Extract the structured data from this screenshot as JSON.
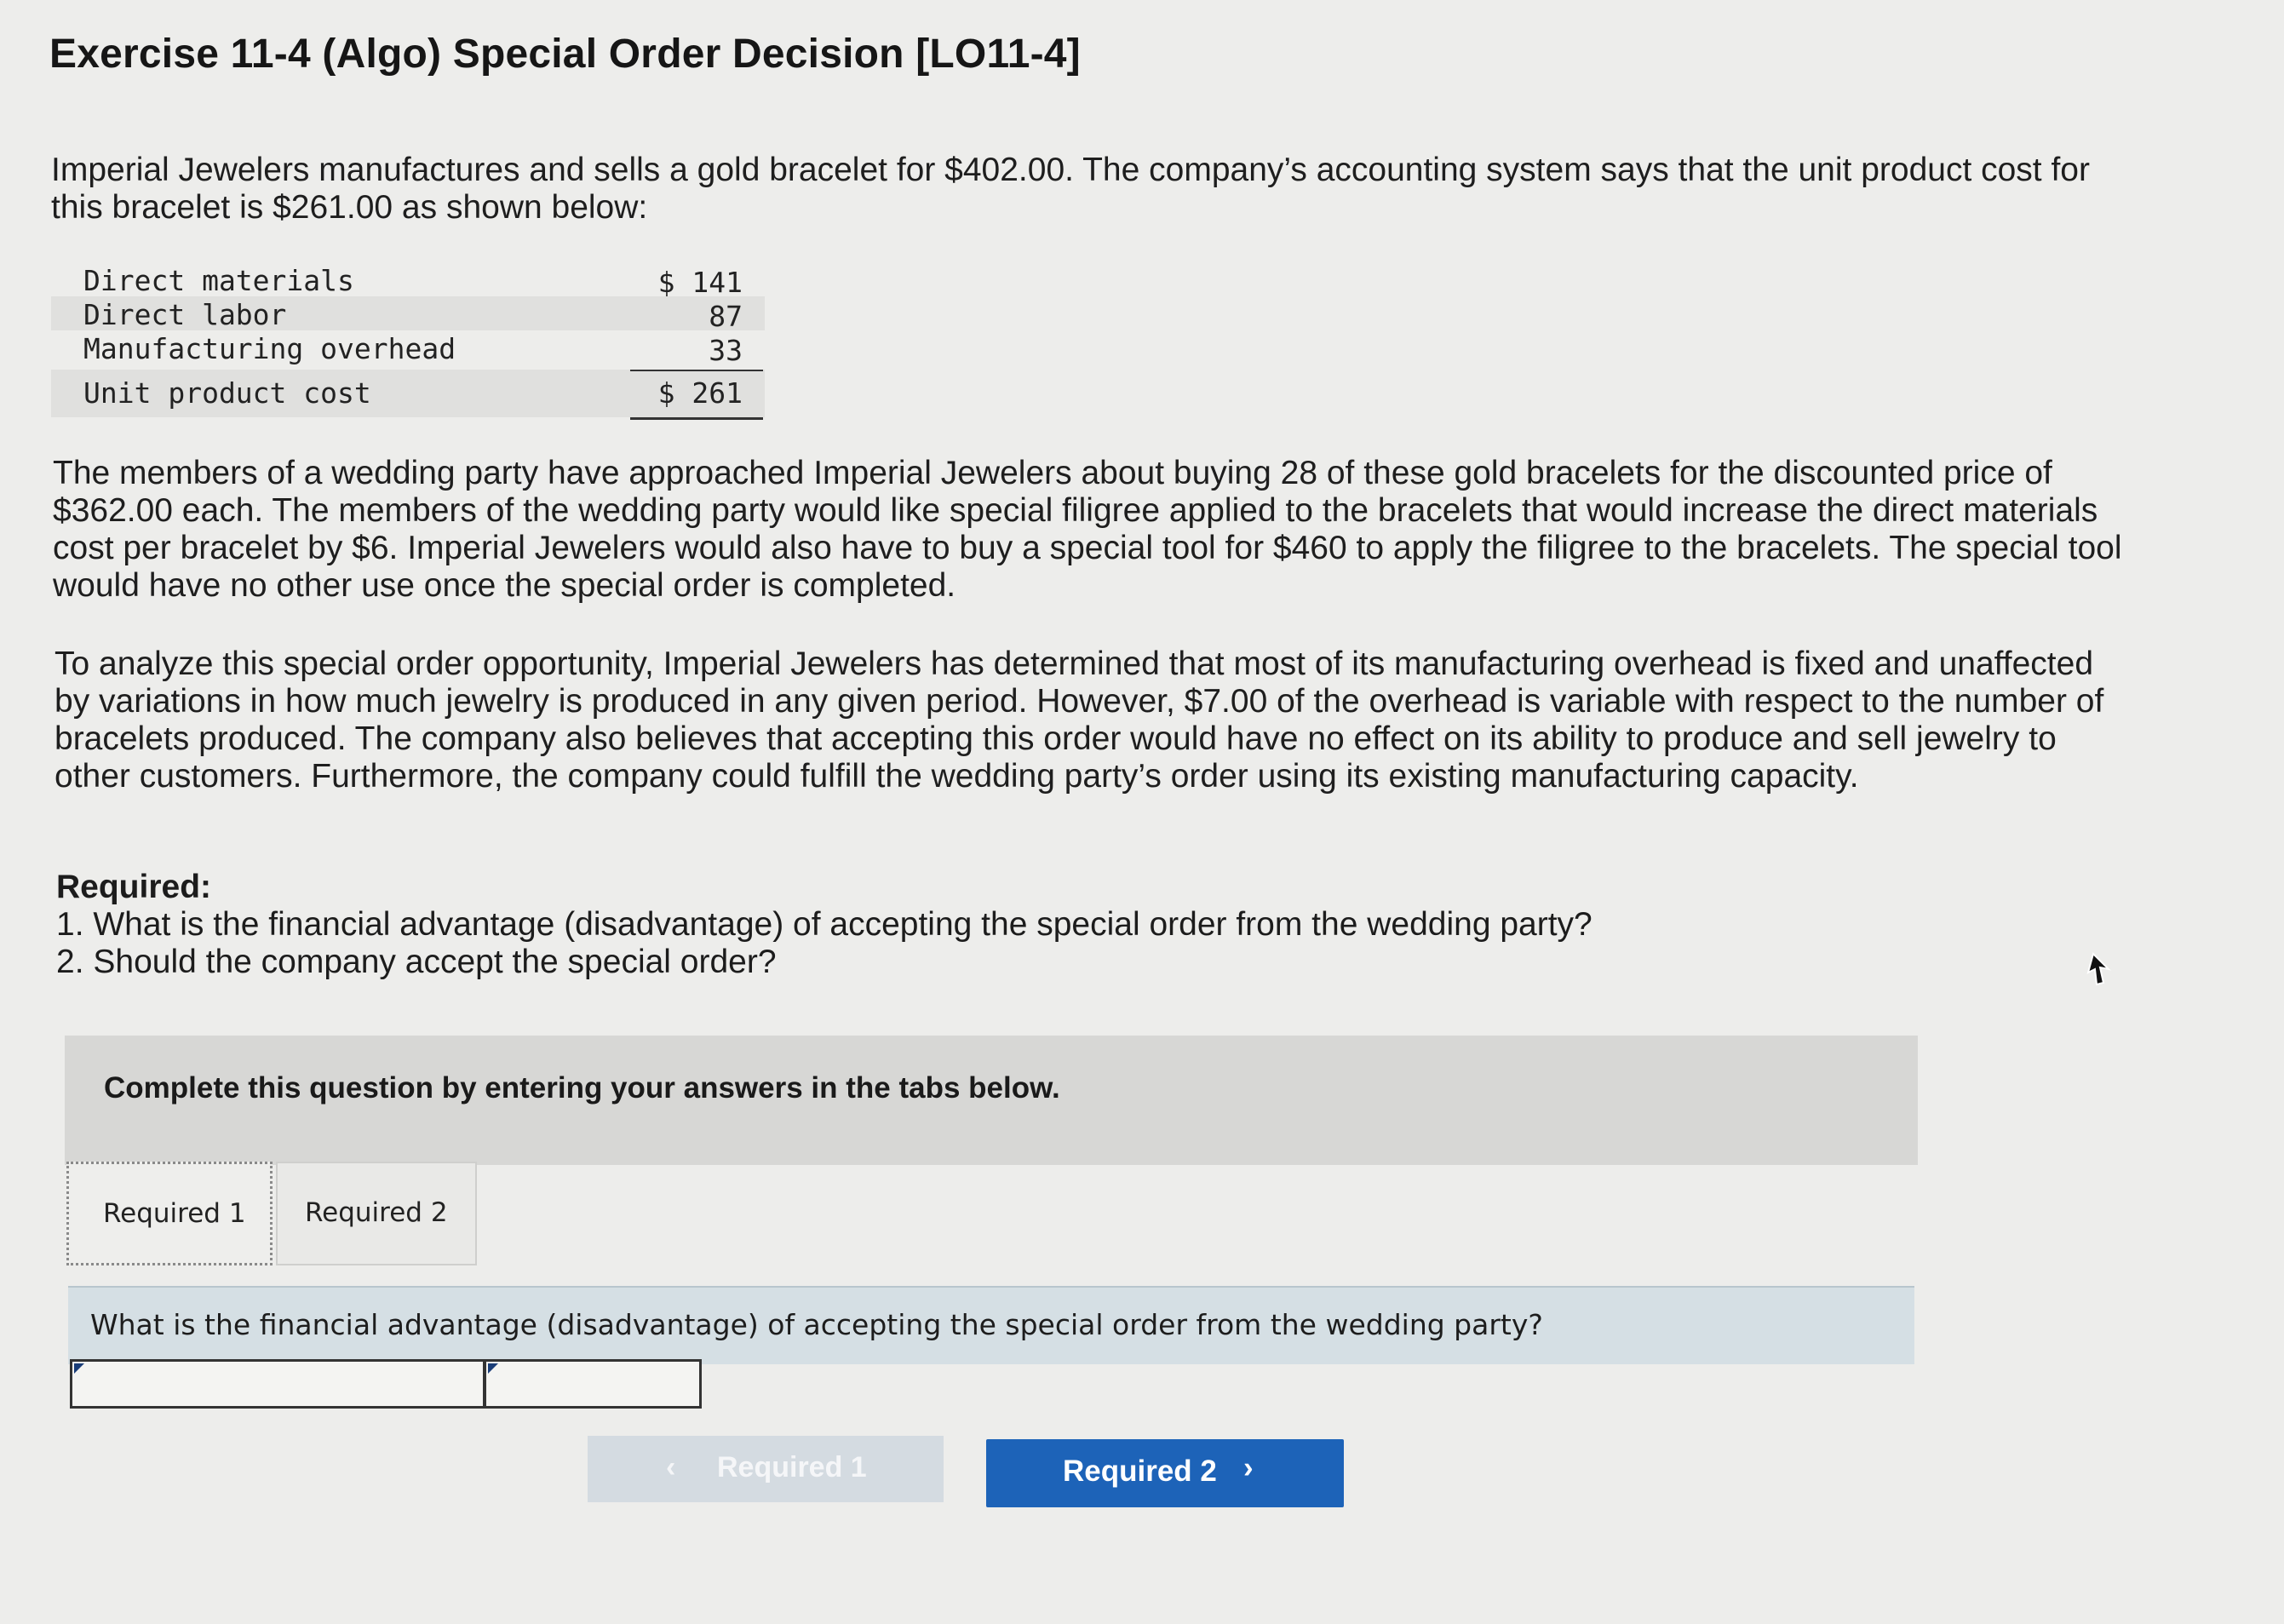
{
  "title": "Exercise 11-4 (Algo) Special Order Decision [LO11-4]",
  "intro": "Imperial Jewelers manufactures and sells a gold bracelet for $402.00. The company’s accounting system says that the unit product cost for this bracelet is $261.00 as shown below:",
  "cost_table": [
    {
      "label": "Direct materials",
      "value": "$ 141"
    },
    {
      "label": "Direct labor",
      "value": "87"
    },
    {
      "label": "Manufacturing overhead",
      "value": "33"
    },
    {
      "label": "Unit product cost",
      "value": "$ 261"
    }
  ],
  "paragraph_order": "The members of a wedding party have approached Imperial Jewelers about buying 28 of these gold bracelets for the discounted price of $362.00 each. The members of the wedding party would like special filigree applied to the bracelets that would increase the direct materials cost per bracelet by $6. Imperial Jewelers would also have to buy a special tool for $460 to apply the filigree to the bracelets. The special tool would have no other use once the special order is completed.",
  "paragraph_analysis": "To analyze this special order opportunity, Imperial Jewelers has determined that most of its manufacturing overhead is fixed and unaffected by variations in how much jewelry is produced in any given period. However, $7.00 of the overhead is variable with respect to the number of bracelets produced. The company also believes that accepting this order would have no effect on its ability to produce and sell jewelry to other customers. Furthermore, the company could fulfill the wedding party’s order using its existing manufacturing capacity.",
  "required": {
    "heading": "Required:",
    "q1": "1. What is the financial advantage (disadvantage) of accepting the special order from the wedding party?",
    "q2": "2. Should the company accept the special order?"
  },
  "panel": {
    "instruction": "Complete this question by entering your answers in the tabs below.",
    "tabs": [
      "Required 1",
      "Required 2"
    ],
    "question": "What is the financial advantage (disadvantage) of accepting the special order from the wedding party?",
    "answer_label_value": "",
    "answer_amount_value": ""
  },
  "nav": {
    "prev_label": "Required 1",
    "next_label": "Required 2"
  },
  "colors": {
    "background": "#ededeb",
    "panel_header": "#d7d7d5",
    "question_bar": "#d5dfe4",
    "next_button": "#1d63b8",
    "prev_button_disabled": "#d4dbe1"
  },
  "icons": {
    "prev": "chevron-left-icon",
    "next": "chevron-right-icon",
    "cursor": "mouse-pointer-icon"
  }
}
